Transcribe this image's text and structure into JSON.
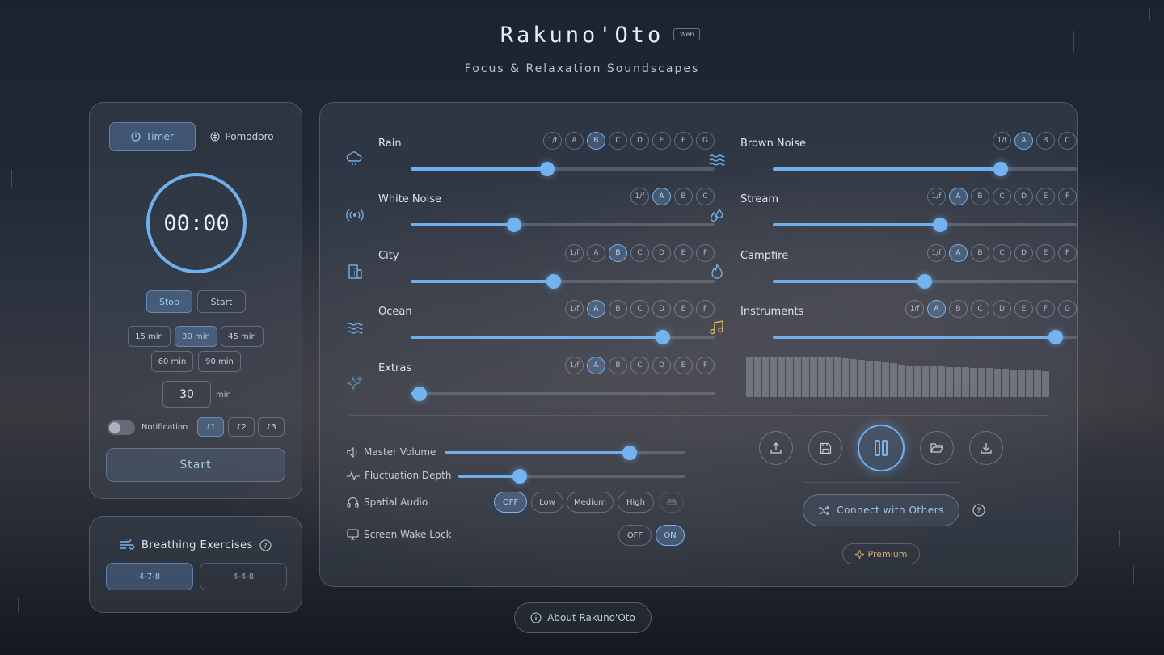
{
  "header": {
    "title": "Rakuno'Oto",
    "badge": "Web",
    "subtitle": "Focus & Relaxation Soundscapes"
  },
  "timer": {
    "tabs": [
      "Timer",
      "Pomodoro"
    ],
    "active_tab": "Timer",
    "display": "00:00",
    "stop_label": "Stop",
    "start_small_label": "Start",
    "presets": [
      "15 min",
      "30 min",
      "45 min",
      "60 min",
      "90 min"
    ],
    "active_preset": "30 min",
    "custom_value": "30",
    "custom_unit": "min",
    "notification_label": "Notification",
    "notification_on": false,
    "sounds": [
      "♪1",
      "♪2",
      "♪3"
    ],
    "active_sound": "♪1",
    "start_label": "Start"
  },
  "breathing": {
    "title": "Breathing Exercises",
    "options": [
      "4-7-8",
      "4-4-8"
    ],
    "active": "4-7-8"
  },
  "channels": [
    {
      "name": "Rain",
      "icon": "cloud-rain-icon",
      "variants": [
        "1/f",
        "A",
        "B",
        "C",
        "D",
        "E",
        "F",
        "G"
      ],
      "selected": "B",
      "level": 0.45
    },
    {
      "name": "White Noise",
      "icon": "broadcast-icon",
      "variants": [
        "1/f",
        "A",
        "B",
        "C"
      ],
      "selected": "A",
      "level": 0.34
    },
    {
      "name": "City",
      "icon": "city-building-icon",
      "variants": [
        "1/f",
        "A",
        "B",
        "C",
        "D",
        "E",
        "F"
      ],
      "selected": "B",
      "level": 0.47
    },
    {
      "name": "Ocean",
      "icon": "waves-icon",
      "variants": [
        "1/f",
        "A",
        "B",
        "C",
        "D",
        "E",
        "F"
      ],
      "selected": "A",
      "level": 0.83
    },
    {
      "name": "Extras",
      "icon": "sparkles-icon",
      "variants": [
        "1/f",
        "A",
        "B",
        "C",
        "D",
        "E",
        "F"
      ],
      "selected": "A",
      "level": 0.03
    },
    {
      "name": "Brown Noise",
      "icon": "waves-icon",
      "variants": [
        "1/f",
        "A",
        "B",
        "C"
      ],
      "selected": "A",
      "level": 0.75
    },
    {
      "name": "Stream",
      "icon": "droplets-icon",
      "variants": [
        "1/f",
        "A",
        "B",
        "C",
        "D",
        "E",
        "F"
      ],
      "selected": "A",
      "level": 0.55
    },
    {
      "name": "Campfire",
      "icon": "flame-icon",
      "variants": [
        "1/f",
        "A",
        "B",
        "C",
        "D",
        "E",
        "F"
      ],
      "selected": "A",
      "level": 0.5
    },
    {
      "name": "Instruments",
      "icon": "music-note-icon",
      "variants": [
        "1/f",
        "A",
        "B",
        "C",
        "D",
        "E",
        "F",
        "G"
      ],
      "selected": "A",
      "level": 0.93
    }
  ],
  "visualizer_levels": [
    1.0,
    1.0,
    1.0,
    1.0,
    1.0,
    1.0,
    1.0,
    1.0,
    1.0,
    1.0,
    1.0,
    1.0,
    0.96,
    0.94,
    0.92,
    0.9,
    0.88,
    0.86,
    0.84,
    0.8,
    0.78,
    0.78,
    0.78,
    0.76,
    0.76,
    0.74,
    0.74,
    0.74,
    0.72,
    0.72,
    0.72,
    0.7,
    0.7,
    0.68,
    0.68,
    0.66,
    0.66,
    0.64
  ],
  "controls": {
    "master_volume_label": "Master Volume",
    "master_volume": 0.77,
    "fluctuation_label": "Fluctuation Depth",
    "fluctuation": 0.27,
    "spatial_label": "Spatial Audio",
    "spatial_options": [
      "OFF",
      "Low",
      "Medium",
      "High"
    ],
    "spatial_active": "OFF",
    "wake_label": "Screen Wake Lock",
    "wake_options": [
      "OFF",
      "ON"
    ],
    "wake_active": "ON"
  },
  "actions": {
    "buttons": [
      "upload-icon",
      "save-icon",
      "pause-icon",
      "folder-open-icon",
      "download-icon"
    ],
    "connect_label": "Connect with Others",
    "premium_label": "Premium"
  },
  "footer": {
    "about_label": "About Rakuno'Oto"
  },
  "colors": {
    "accent": "#6fb0ec",
    "premium": "#d4ad6e",
    "instrument_icon": "#e0b65a"
  }
}
